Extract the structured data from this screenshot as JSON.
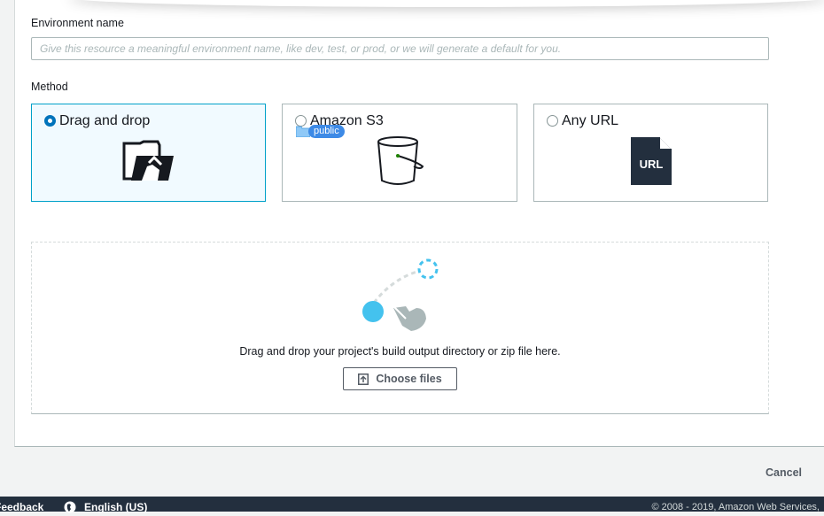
{
  "environment": {
    "label": "Environment name",
    "placeholder": "Give this resource a meaningful environment name, like dev, test, or prod, or we will generate a default for you."
  },
  "method": {
    "label": "Method",
    "options": [
      {
        "label": "Drag and drop",
        "icon": "folder-upload-icon",
        "selected": true
      },
      {
        "label": "Amazon S3",
        "icon": "s3-bucket-icon",
        "selected": false,
        "tag": "public"
      },
      {
        "label": "Any URL",
        "icon": "url-file-icon",
        "selected": false
      }
    ]
  },
  "dropzone": {
    "icon": "drag-gesture-icon",
    "text": "Drag and drop your project's build output directory or zip file here.",
    "button": {
      "label": "Choose files",
      "icon": "upload-icon"
    }
  },
  "actions": {
    "cancel": "Cancel"
  },
  "footer": {
    "feedback": "Feedback",
    "language_icon": "globe-icon",
    "language": "English (US)",
    "copyright": "© 2008 - 2019, Amazon Web Services,"
  },
  "colors": {
    "selected_border": "#00a1c9",
    "selected_fill": "#f1faff",
    "radio_checked": "#0073bb",
    "footer_bg": "#232f3e",
    "accent_blue": "#44c2ee",
    "tag_blue": "#3d8ae6"
  }
}
